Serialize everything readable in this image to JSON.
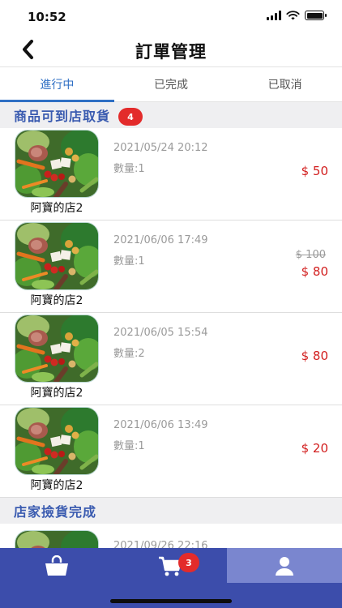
{
  "status_bar": {
    "time": "10:52"
  },
  "header": {
    "title": "訂單管理"
  },
  "tabs": [
    {
      "label": "進行中",
      "active": true
    },
    {
      "label": "已完成",
      "active": false
    },
    {
      "label": "已取消",
      "active": false
    }
  ],
  "sections": [
    {
      "title": "商品可到店取貨",
      "badge": "4",
      "orders": [
        {
          "shop": "阿寶的店2",
          "date": "2021/05/24 20:12",
          "quantity": "數量:1",
          "price": "$ 50",
          "original_price": ""
        },
        {
          "shop": "阿寶的店2",
          "date": "2021/06/06 17:49",
          "quantity": "數量:1",
          "price": "$ 80",
          "original_price": "$ 100"
        },
        {
          "shop": "阿寶的店2",
          "date": "2021/06/05 15:54",
          "quantity": "數量:2",
          "price": "$ 80",
          "original_price": ""
        },
        {
          "shop": "阿寶的店2",
          "date": "2021/06/06 13:49",
          "quantity": "數量:1",
          "price": "$ 20",
          "original_price": ""
        }
      ]
    },
    {
      "title": "店家撿貨完成",
      "badge": "",
      "orders": [
        {
          "shop": "",
          "date": "2021/09/26 22:16",
          "quantity": "",
          "price": "",
          "original_price": ""
        }
      ]
    }
  ],
  "bottom_nav": {
    "items": [
      {
        "icon": "shopping-bag-icon",
        "active": false
      },
      {
        "icon": "cart-icon",
        "active": false,
        "badge": "3"
      },
      {
        "icon": "user-icon",
        "active": true
      }
    ]
  },
  "colors": {
    "accent": "#2f6fc4",
    "section_title": "#3a5bb0",
    "price": "#d21f1f",
    "badge": "#e32b2b",
    "nav_bg": "#3c4dab",
    "nav_active": "#7a86cf"
  }
}
